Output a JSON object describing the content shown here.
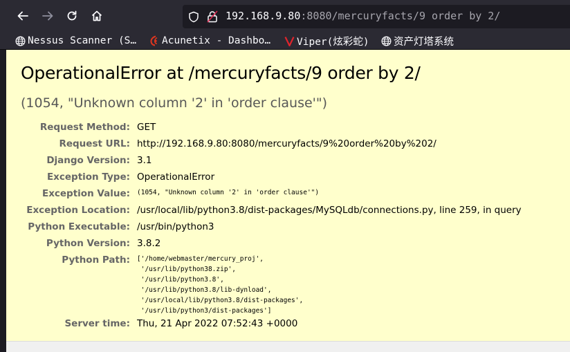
{
  "browser": {
    "url_host": "192.168.9.80",
    "url_rest": ":8080/mercuryfacts/9 order by 2/",
    "nav_icons": [
      "back-arrow-icon",
      "forward-arrow-icon",
      "reload-icon",
      "home-icon"
    ],
    "bookmarks": [
      {
        "label": "Nessus Scanner (S…",
        "icon": "globe-icon"
      },
      {
        "label": "Acunetix - Dashbo…",
        "icon": "acunetix-icon"
      },
      {
        "label": "Viper(炫彩蛇)",
        "icon": "viper-icon"
      },
      {
        "label": "资产灯塔系统",
        "icon": "globe-icon"
      }
    ]
  },
  "error": {
    "title": "OperationalError at /mercuryfacts/9 order by 2/",
    "value": "(1054, \"Unknown column '2' in 'order clause'\")"
  },
  "meta": [
    {
      "label": "Request Method:",
      "value": "GET"
    },
    {
      "label": "Request URL:",
      "value": "http://192.168.9.80:8080/mercuryfacts/9%20order%20by%202/"
    },
    {
      "label": "Django Version:",
      "value": "3.1"
    },
    {
      "label": "Exception Type:",
      "value": "OperationalError"
    },
    {
      "label": "Exception Value:",
      "value": "(1054, \"Unknown column '2' in 'order clause'\")"
    },
    {
      "label": "Exception Location:",
      "value": "/usr/local/lib/python3.8/dist-packages/MySQLdb/connections.py, line 259, in query"
    },
    {
      "label": "Python Executable:",
      "value": "/usr/bin/python3"
    },
    {
      "label": "Python Version:",
      "value": "3.8.2"
    },
    {
      "label": "Python Path:",
      "value": "['/home/webmaster/mercury_proj',\n '/usr/lib/python38.zip',\n '/usr/lib/python3.8',\n '/usr/lib/python3.8/lib-dynload',\n '/usr/local/lib/python3.8/dist-packages',\n '/usr/lib/python3/dist-packages']"
    },
    {
      "label": "Server time:",
      "value": "Thu, 21 Apr 2022 07:52:43 +0000"
    }
  ],
  "colors": {
    "page_bg": "#ffffcc",
    "label": "#666666",
    "chrome": "#2b2a33",
    "acunetix": "#e0361f",
    "viper": "#e0242c"
  }
}
